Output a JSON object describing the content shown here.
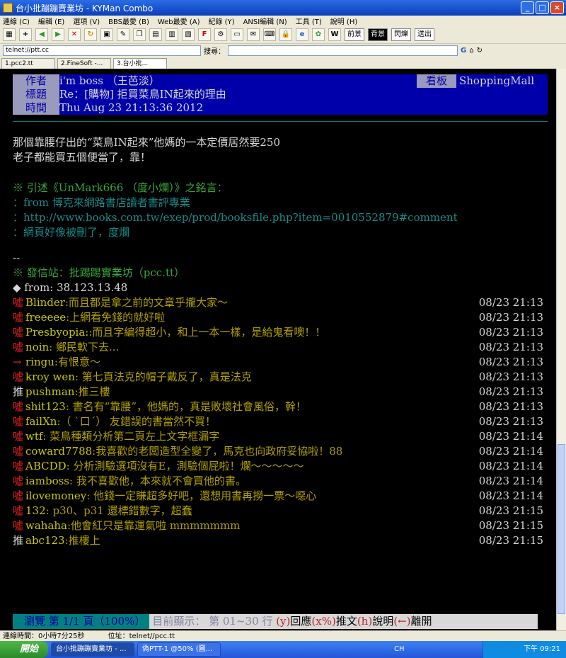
{
  "window": {
    "title": "台小批蹦蹦賣業坊 - KYMan Combo",
    "buttons": {
      "minimize": "_",
      "maximize": "□",
      "close": "×"
    }
  },
  "menu": [
    "連線 (C)",
    "編輯 (E)",
    "選項 (V)",
    "BBS最愛 (B)",
    "Web最愛 (A)",
    "紀錄 (Y)",
    "ANSI編輯 (N)",
    "工具 (T)",
    "說明 (H)"
  ],
  "toolbar": {
    "bg_label": "前景",
    "fg_label": "背景",
    "flash_label": "閃爍",
    "send_label": "送出"
  },
  "address": {
    "url": "telnet://ptt.cc",
    "search_label": "搜尋："
  },
  "tabs": [
    {
      "label": "1.pcc2.tt"
    },
    {
      "label": "2.FineSoft -..."
    },
    {
      "label": "3.台小批..."
    }
  ],
  "post": {
    "author_label": "作者",
    "author": "i'm boss （王芭淡）",
    "board_label": "看板",
    "board": "ShoppingMall",
    "title_label": "標題",
    "title": "Re：[購物] 拒買菜鳥IN起來的理由",
    "time_label": "時間",
    "time": "Thu Aug 23  21:13:36 2012",
    "body": [
      "那個靠腰仔出的“菜鳥IN起來”他媽的一本定價居然要250",
      "老子都能買五個便當了，靠！"
    ],
    "quote_header": "※ 引述《UnMark666 （度小爛）》之銘言：",
    "quote_lines": [
      "：from 博克來網路書店讀者書評專業",
      "：http://www.books.com.tw/exep/prod/booksfile.php?item=0010552879#comment",
      "：網頁好像被刪了，度爛"
    ],
    "sig_sep": "--",
    "sig_station": "※ 發信站：批踢踢實業坊（pcc.tt）",
    "sig_from": "◆ from: 38.123.13.48"
  },
  "pushes": [
    {
      "tag": "噓",
      "user": "Blinder",
      "text": ":而且都是拿之前的文章乎攏大家～",
      "time": "08/23 21:13"
    },
    {
      "tag": "噓",
      "user": "freeeee",
      "text": ":上網看免錢的就好啦",
      "time": "08/23 21:13"
    },
    {
      "tag": "噓",
      "user": "Presbyopia:",
      "text": ":而且字編得超小，和上一本一樣，是給鬼看噢！！",
      "time": "08/23 21:13"
    },
    {
      "tag": "噓",
      "user": "noin",
      "text": ": 鄉民軟下去...",
      "time": "08/23 21:13"
    },
    {
      "tag": "→",
      "user": "ringu",
      "text": ":有恨意～",
      "time": "08/23 21:13"
    },
    {
      "tag": "噓",
      "user": "kroy wen",
      "text": ": 第七頁法克的帽子戴反了，真是法克",
      "time": "08/23 21:13"
    },
    {
      "tag": "推",
      "user": "pushman",
      "text": ":推三樓",
      "time": "08/23 21:13"
    },
    {
      "tag": "噓",
      "user": "shit123",
      "text": ": 書名有“靠腰”，他媽的，真是敗壞社會風俗，幹！",
      "time": "08/23 21:13"
    },
    {
      "tag": "噓",
      "user": "failXn",
      "text": ":（ ˋ口ˊ） 友錯誤的書當然不買！",
      "time": "08/23 21:13"
    },
    {
      "tag": "噓",
      "user": "wtf",
      "text": ": 菜鳥種類分析第二頁左上文字框漏字",
      "time": "08/23 21:14"
    },
    {
      "tag": "噓",
      "user": "coward7788",
      "text": ":我喜歡的老闆造型全變了，馬克也向政府妥協啦！88",
      "time": "08/23 21:14"
    },
    {
      "tag": "噓",
      "user": "ABCDD",
      "text": ": 分析測驗選項沒有E，測驗個屁啦！爛～～～～～",
      "time": "08/23 21:14"
    },
    {
      "tag": "噓",
      "user": "iamboss",
      "text": ": 我不喜歡他，本來就不會買他的書。",
      "time": "08/23 21:14"
    },
    {
      "tag": "噓",
      "user": "ilovemoney",
      "text": ": 他錢一定賺超多好吧，還想用書再撈一票～噁心",
      "time": "08/23 21:14"
    },
    {
      "tag": "噓",
      "user": "132",
      "text": ": p30、p31 還標錯數字，超蠢",
      "time": "08/23 21:15"
    },
    {
      "tag": "噓",
      "user": "wahaha",
      "text": ":他會紅只是靠運氣啦 mmmmmmm",
      "time": "08/23 21:15"
    },
    {
      "tag": "推",
      "user": "abc123",
      "text": ":推樓上",
      "time": "08/23 21:15"
    }
  ],
  "status": {
    "browse": "瀏覽 第 1/1 頁（100%）",
    "showing": "目前顯示： 第 01~30 行",
    "k1": "(y)",
    "t1": "回應",
    "k2": "(x%)",
    "t2": "推文",
    "k3": "(h)",
    "t3": "說明",
    "k4": "(←)",
    "t4": "離開"
  },
  "statusbar": {
    "online": "連線時間：0小時7分25秒",
    "address": "位址：telnet//pcc.tt"
  },
  "taskbar": {
    "start": "開始",
    "tasks": [
      "台小批蹦蹦賣業坊 - ...",
      "偽PTT-1 @50% (圖..."
    ],
    "lang": "CH",
    "clock": "下午 09:21"
  },
  "colors": {
    "header_bg": "#0000aa",
    "terminal_bg": "#000000",
    "push_boo": "#e02020",
    "push_text": "#c8c800"
  }
}
